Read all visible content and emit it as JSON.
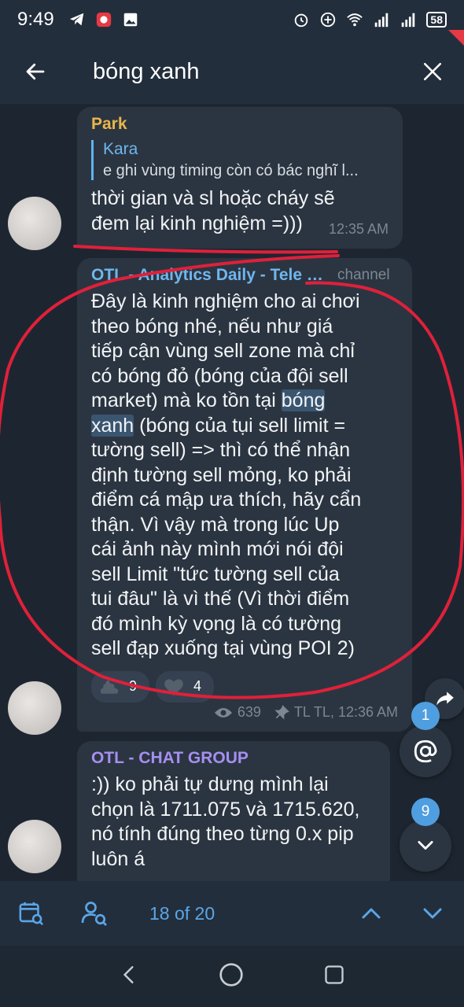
{
  "status_bar": {
    "time": "9:49",
    "battery": "58"
  },
  "app_bar": {
    "search_query": "bóng xanh"
  },
  "messages": [
    {
      "sender": "Park",
      "sender_color": "#e8b64b",
      "reply": {
        "name": "Kara",
        "text": "e ghi vùng timing còn có bác nghĩ l..."
      },
      "lines": [
        "thời gian và sl hoặc cháy sẽ",
        "đem lại kinh nghiệm =)))"
      ],
      "time": "12:35 AM"
    },
    {
      "sender": "OTL - Analytics Daily - Tele C...",
      "sender_color": "#6fb6ee",
      "tag": "channel",
      "lines": [
        "Đây là kinh nghiệm cho ai chơi",
        "theo bóng nhé, nếu như giá",
        "tiếp cận vùng sell zone mà chỉ",
        "có bóng đỏ (bóng của đội sell",
        "market) mà ko tồn tại",
        "xanh",
        "(bóng của tụi sell limit =",
        "tường sell) => thì có thể nhận",
        "định tường sell mỏng, ko phải",
        "điểm cá mập ưa thích, hãy cẩn",
        "thận. Vì vậy mà trong lúc Up",
        "cái ảnh này mình mới nói đội",
        "sell Limit \"tức tường sell của",
        "tui đâu\" là vì thế (Vì thời điểm",
        "đó mình kỳ vọng là có tường",
        "sell đạp xuống tại vùng POI 2)"
      ],
      "highlight_1": "bóng",
      "reactions": [
        {
          "icon": "poop-icon",
          "count": "9"
        },
        {
          "icon": "heart-icon",
          "count": "4"
        }
      ],
      "views": "639",
      "time": "TL TL, 12:36 AM"
    },
    {
      "sender": "OTL - CHAT GROUP",
      "sender_color": "#a58ff0",
      "lines": [
        ":)) ko phải tự dưng mình lại",
        "chọn là 1711.075 và 1715.620,",
        "nó tính đúng theo từng 0.x pip",
        "luôn á"
      ]
    }
  ],
  "floating": {
    "mention_badge": "1",
    "down_badge": "9"
  },
  "bottom_bar": {
    "counter": "18 of 20"
  },
  "colors": {
    "accent": "#5aa6e8",
    "annotation_red": "#e0203a"
  }
}
